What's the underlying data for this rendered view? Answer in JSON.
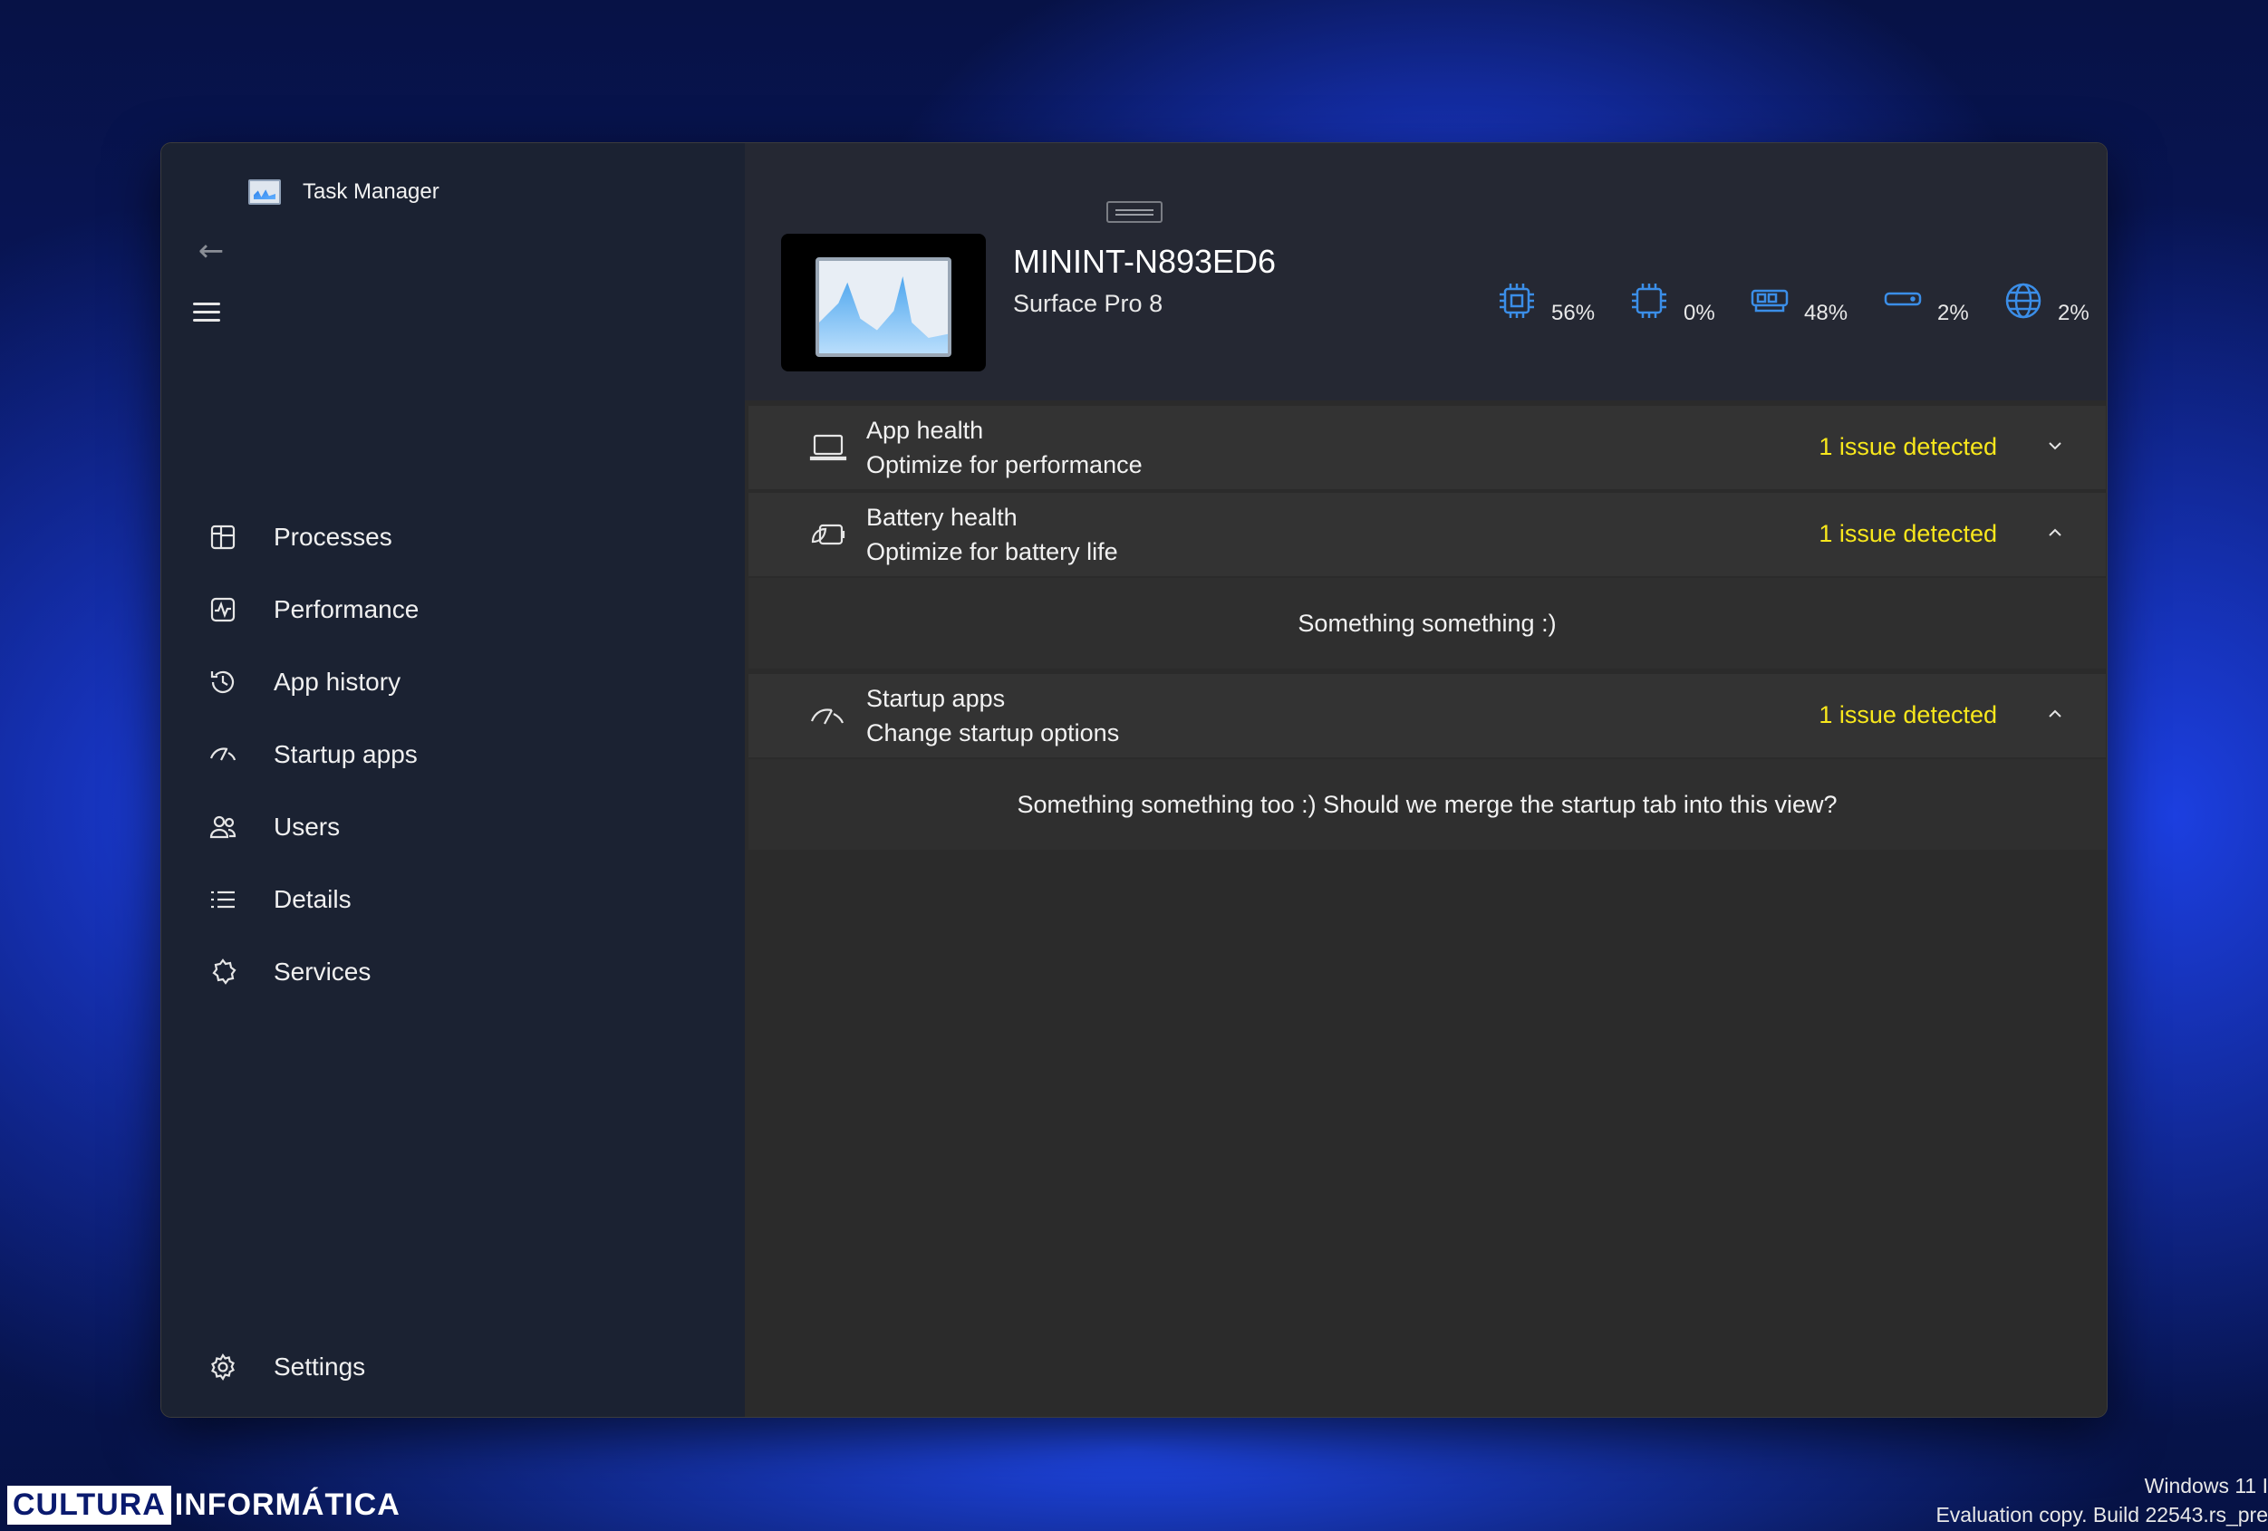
{
  "window": {
    "title": "Task Manager"
  },
  "sidebar": {
    "items": [
      {
        "label": "Processes",
        "icon": "processes-icon"
      },
      {
        "label": "Performance",
        "icon": "performance-icon"
      },
      {
        "label": "App history",
        "icon": "history-icon"
      },
      {
        "label": "Startup apps",
        "icon": "startup-icon"
      },
      {
        "label": "Users",
        "icon": "users-icon"
      },
      {
        "label": "Details",
        "icon": "details-icon"
      },
      {
        "label": "Services",
        "icon": "services-icon"
      }
    ],
    "settings_label": "Settings"
  },
  "header": {
    "hostname": "MININT-N893ED6",
    "model": "Surface Pro 8",
    "metrics": [
      {
        "icon": "cpu-icon",
        "value": "56%"
      },
      {
        "icon": "gpu-chip-icon",
        "value": "0%"
      },
      {
        "icon": "memory-icon",
        "value": "48%"
      },
      {
        "icon": "disk-icon",
        "value": "2%"
      },
      {
        "icon": "network-globe-icon",
        "value": "2%"
      }
    ]
  },
  "cards": [
    {
      "title": "App health",
      "subtitle": "Optimize for performance",
      "issue": "1 issue detected",
      "expanded": false
    },
    {
      "title": "Battery health",
      "subtitle": "Optimize for battery life",
      "issue": "1 issue detected",
      "expanded": true,
      "body": "Something something :)"
    },
    {
      "title": "Startup apps",
      "subtitle": "Change startup options",
      "issue": "1 issue detected",
      "expanded": true,
      "body": "Something something too :) Should we merge the startup tab into this view?"
    }
  ],
  "desktop": {
    "brand_part1": "CULTURA",
    "brand_part2": "INFORMÁTICA",
    "watermark_line1": "Windows 11 I",
    "watermark_line2": "Evaluation copy. Build 22543.rs_pre"
  },
  "colors": {
    "accent": "#3b8ee8",
    "issue": "#f8e71c",
    "sidebar": "#1b2232",
    "content": "#2b2b2b"
  }
}
